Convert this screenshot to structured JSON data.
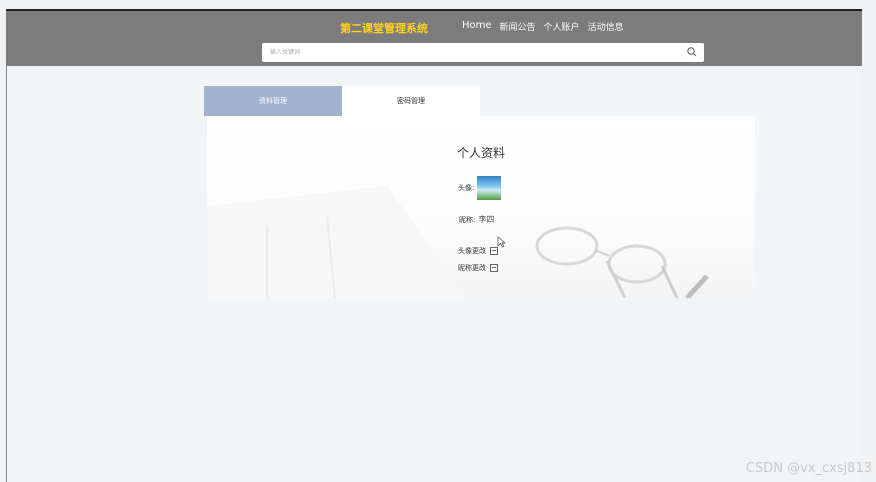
{
  "header": {
    "brand": "第二课堂管理系统",
    "nav": [
      "Home",
      "新闻公告",
      "个人账户",
      "活动信息"
    ]
  },
  "search": {
    "placeholder": "输入关键词"
  },
  "tabs": [
    {
      "label": "资料管理",
      "active": true
    },
    {
      "label": "密码管理",
      "active": false
    }
  ],
  "profile": {
    "title": "个人资料",
    "avatar_label": "头像:",
    "nickname_label": "昵称:",
    "nickname_value": "李四",
    "change_avatar": "头像更改",
    "change_nickname": "昵称更改"
  },
  "watermark": "CSDN @vx_cxsj813",
  "colors": {
    "header": "#7c7c7c",
    "brand": "#ffd21f",
    "active_tab": "#a0b3cc"
  }
}
